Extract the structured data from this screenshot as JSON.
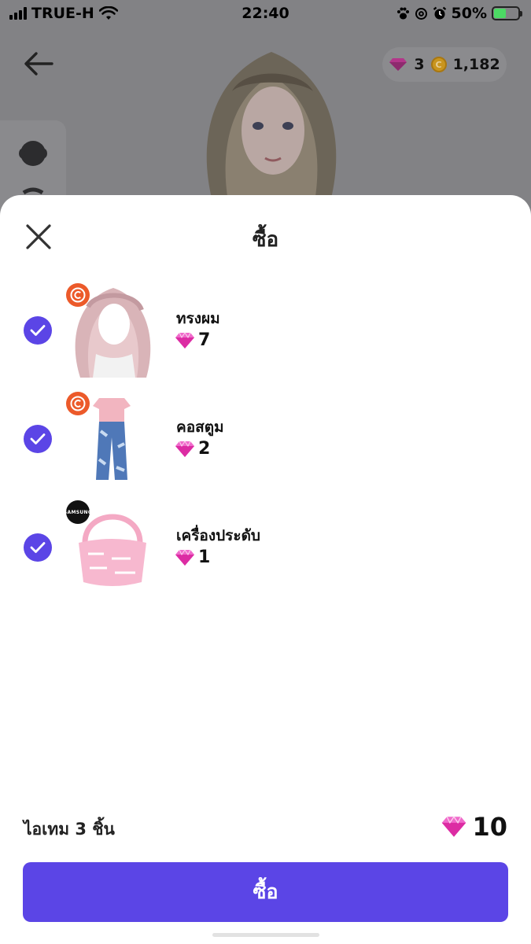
{
  "status_bar": {
    "carrier": "TRUE-H",
    "time": "22:40",
    "battery": "50%",
    "battery_level": 0.5
  },
  "header": {
    "gems": "3",
    "coins": "1,182"
  },
  "sheet": {
    "title": "ซื้อ",
    "items": [
      {
        "name": "ทรงผม",
        "price": "7",
        "brand": "copyright-c",
        "checked": true
      },
      {
        "name": "คอสตูม",
        "price": "2",
        "brand": "copyright-c",
        "checked": true
      },
      {
        "name": "เครื่องประดับ",
        "price": "1",
        "brand": "SAMSUNG",
        "checked": true
      }
    ],
    "total_label": "ไอเทม 3 ชิ้น",
    "total_price": "10",
    "buy_label": "ซื้อ"
  },
  "colors": {
    "accent": "#5b45e6",
    "gem": "#e83fae",
    "brand_badge": "#ec5a2a"
  }
}
